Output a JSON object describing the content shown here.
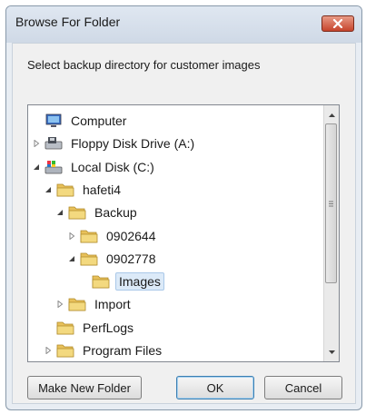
{
  "window": {
    "title": "Browse For Folder",
    "close_icon": "close-icon"
  },
  "instruction": "Select backup directory for customer images",
  "tree": {
    "items": [
      {
        "label": "Computer",
        "icon": "computer-icon",
        "depth": 0,
        "toggle": "none",
        "selected": false
      },
      {
        "label": "Floppy Disk Drive (A:)",
        "icon": "floppy-drive-icon",
        "depth": 0,
        "toggle": "collapsed",
        "selected": false
      },
      {
        "label": "Local Disk (C:)",
        "icon": "local-disk-icon",
        "depth": 0,
        "toggle": "expanded",
        "selected": false
      },
      {
        "label": "hafeti4",
        "icon": "folder-icon",
        "depth": 1,
        "toggle": "expanded",
        "selected": false
      },
      {
        "label": "Backup",
        "icon": "folder-icon",
        "depth": 2,
        "toggle": "expanded",
        "selected": false
      },
      {
        "label": "0902644",
        "icon": "folder-icon",
        "depth": 3,
        "toggle": "collapsed",
        "selected": false
      },
      {
        "label": "0902778",
        "icon": "folder-icon",
        "depth": 3,
        "toggle": "expanded",
        "selected": false
      },
      {
        "label": "Images",
        "icon": "folder-icon",
        "depth": 4,
        "toggle": "none",
        "selected": true
      },
      {
        "label": "Import",
        "icon": "folder-icon",
        "depth": 2,
        "toggle": "collapsed",
        "selected": false
      },
      {
        "label": "PerfLogs",
        "icon": "folder-icon",
        "depth": 1,
        "toggle": "none",
        "selected": false
      },
      {
        "label": "Program Files",
        "icon": "folder-icon",
        "depth": 1,
        "toggle": "collapsed",
        "selected": false
      }
    ]
  },
  "buttons": {
    "make_new_folder": "Make New Folder",
    "ok": "OK",
    "cancel": "Cancel"
  },
  "colors": {
    "folder": "#e8c15a",
    "selection": "#dceaf8"
  }
}
